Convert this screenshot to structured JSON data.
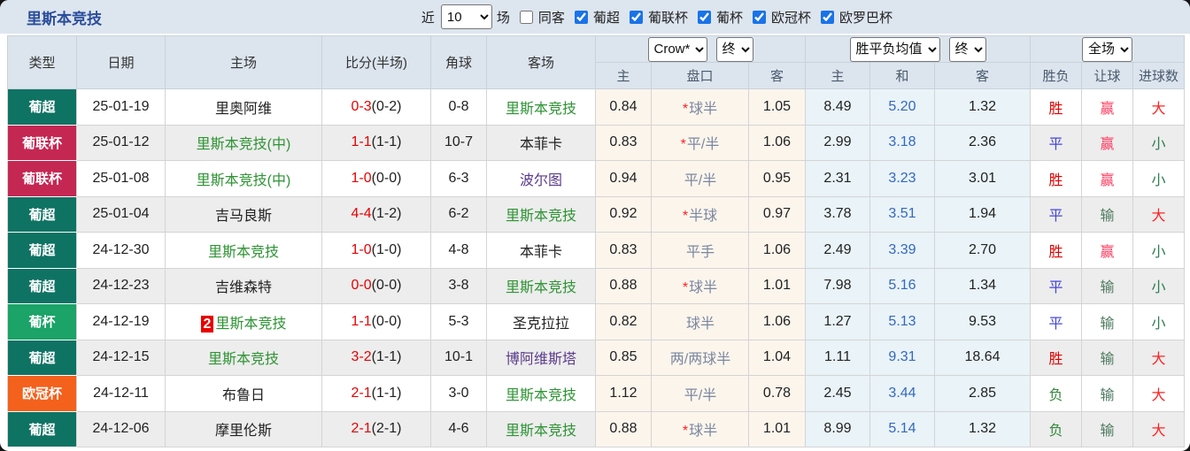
{
  "topbar": {
    "title": "里斯本竞技",
    "near_label": "近",
    "near_value": "10",
    "games_label": "场",
    "same_away_label": "同客",
    "leagues": [
      {
        "label": "葡超",
        "checked": true
      },
      {
        "label": "葡联杯",
        "checked": true
      },
      {
        "label": "葡杯",
        "checked": true
      },
      {
        "label": "欧冠杯",
        "checked": true
      },
      {
        "label": "欧罗巴杯",
        "checked": true
      }
    ]
  },
  "table": {
    "columns": {
      "type": "类型",
      "date": "日期",
      "home": "主场",
      "score": "比分(半场)",
      "corner": "角球",
      "away": "客场"
    },
    "dropdowns": {
      "odds_company": "Crow*",
      "odds_time": "终",
      "avg": "胜平负均值",
      "avg_time": "终",
      "scope": "全场"
    },
    "subcolumns": [
      "主",
      "盘口",
      "客",
      "主",
      "和",
      "客",
      "胜负",
      "让球",
      "进球数"
    ],
    "league_colors": {
      "葡超": "#0f7364",
      "葡联杯": "#c52753",
      "葡杯": "#1ba368",
      "欧冠杯": "#f4611c"
    },
    "status_colors": {
      "win_red": "#e60000",
      "draw_blue": "#4444e0",
      "lose_green": "#338a3e",
      "cover_win": "#ff3a5e",
      "cover_lose": "#4e7a60",
      "big": "#ff2222",
      "small": "#2e7d52",
      "avg_draw_blue": "#3468c0",
      "team_green": "#2e9434",
      "team_purple": "#5b3b8c"
    },
    "rows": [
      {
        "league": "葡超",
        "league_color": "#0f7364",
        "date": "25-01-19",
        "home": "里奥阿维",
        "home_cls": "t-dark",
        "home_prefix": "",
        "score": "0-3",
        "half": "(0-2)",
        "corner": "0-8",
        "away": "里斯本竞技",
        "away_cls": "t-green",
        "crow_home": "0.84",
        "star": "*",
        "handicap": "球半",
        "crow_away": "1.05",
        "avg_home": "8.49",
        "avg_draw": "5.20",
        "avg_away": "1.32",
        "result": "胜",
        "result_cls": "r-win",
        "cover": "赢",
        "cover_cls": "c-win",
        "goals": "大",
        "goals_cls": "g-big"
      },
      {
        "league": "葡联杯",
        "league_color": "#c52753",
        "date": "25-01-12",
        "home": "里斯本竞技(中)",
        "home_cls": "t-green",
        "home_prefix": "",
        "score": "1-1",
        "half": "(1-1)",
        "corner": "10-7",
        "away": "本菲卡",
        "away_cls": "t-dark",
        "crow_home": "0.83",
        "star": "*",
        "handicap": "平/半",
        "crow_away": "1.06",
        "avg_home": "2.99",
        "avg_draw": "3.18",
        "avg_away": "2.36",
        "result": "平",
        "result_cls": "r-draw",
        "cover": "赢",
        "cover_cls": "c-win",
        "goals": "小",
        "goals_cls": "g-small"
      },
      {
        "league": "葡联杯",
        "league_color": "#c52753",
        "date": "25-01-08",
        "home": "里斯本竞技(中)",
        "home_cls": "t-green",
        "home_prefix": "",
        "score": "1-0",
        "half": "(0-0)",
        "corner": "6-3",
        "away": "波尔图",
        "away_cls": "t-purple",
        "crow_home": "0.94",
        "star": "",
        "handicap": "平/半",
        "crow_away": "0.95",
        "avg_home": "2.31",
        "avg_draw": "3.23",
        "avg_away": "3.01",
        "result": "胜",
        "result_cls": "r-win",
        "cover": "赢",
        "cover_cls": "c-win",
        "goals": "小",
        "goals_cls": "g-small"
      },
      {
        "league": "葡超",
        "league_color": "#0f7364",
        "date": "25-01-04",
        "home": "吉马良斯",
        "home_cls": "t-dark",
        "home_prefix": "",
        "score": "4-4",
        "half": "(1-2)",
        "corner": "6-2",
        "away": "里斯本竞技",
        "away_cls": "t-green",
        "crow_home": "0.92",
        "star": "*",
        "handicap": "半球",
        "crow_away": "0.97",
        "avg_home": "3.78",
        "avg_draw": "3.51",
        "avg_away": "1.94",
        "result": "平",
        "result_cls": "r-draw",
        "cover": "输",
        "cover_cls": "c-lose",
        "goals": "大",
        "goals_cls": "g-big"
      },
      {
        "league": "葡超",
        "league_color": "#0f7364",
        "date": "24-12-30",
        "home": "里斯本竞技",
        "home_cls": "t-green",
        "home_prefix": "",
        "score": "1-0",
        "half": "(1-0)",
        "corner": "4-8",
        "away": "本菲卡",
        "away_cls": "t-dark",
        "crow_home": "0.83",
        "star": "",
        "handicap": "平手",
        "crow_away": "1.06",
        "avg_home": "2.49",
        "avg_draw": "3.39",
        "avg_away": "2.70",
        "result": "胜",
        "result_cls": "r-win",
        "cover": "赢",
        "cover_cls": "c-win",
        "goals": "小",
        "goals_cls": "g-small"
      },
      {
        "league": "葡超",
        "league_color": "#0f7364",
        "date": "24-12-23",
        "home": "吉维森特",
        "home_cls": "t-dark",
        "home_prefix": "",
        "score": "0-0",
        "half": "(0-0)",
        "corner": "3-8",
        "away": "里斯本竞技",
        "away_cls": "t-green",
        "crow_home": "0.88",
        "star": "*",
        "handicap": "球半",
        "crow_away": "1.01",
        "avg_home": "7.98",
        "avg_draw": "5.16",
        "avg_away": "1.34",
        "result": "平",
        "result_cls": "r-draw",
        "cover": "输",
        "cover_cls": "c-lose",
        "goals": "小",
        "goals_cls": "g-small"
      },
      {
        "league": "葡杯",
        "league_color": "#1ba368",
        "date": "24-12-19",
        "home": "里斯本竞技",
        "home_cls": "t-green",
        "home_prefix": "2",
        "score": "1-1",
        "half": "(0-0)",
        "corner": "5-3",
        "away": "圣克拉拉",
        "away_cls": "t-dark",
        "crow_home": "0.82",
        "star": "",
        "handicap": "球半",
        "crow_away": "1.06",
        "avg_home": "1.27",
        "avg_draw": "5.13",
        "avg_away": "9.53",
        "result": "平",
        "result_cls": "r-draw",
        "cover": "输",
        "cover_cls": "c-lose",
        "goals": "小",
        "goals_cls": "g-small"
      },
      {
        "league": "葡超",
        "league_color": "#0f7364",
        "date": "24-12-15",
        "home": "里斯本竞技",
        "home_cls": "t-green",
        "home_prefix": "",
        "score": "3-2",
        "half": "(1-1)",
        "corner": "10-1",
        "away": "博阿维斯塔",
        "away_cls": "t-purple",
        "crow_home": "0.85",
        "star": "",
        "handicap": "两/两球半",
        "crow_away": "1.04",
        "avg_home": "1.11",
        "avg_draw": "9.31",
        "avg_away": "18.64",
        "result": "胜",
        "result_cls": "r-win",
        "cover": "输",
        "cover_cls": "c-lose",
        "goals": "大",
        "goals_cls": "g-big"
      },
      {
        "league": "欧冠杯",
        "league_color": "#f4611c",
        "date": "24-12-11",
        "home": "布鲁日",
        "home_cls": "t-dark",
        "home_prefix": "",
        "score": "2-1",
        "half": "(1-1)",
        "corner": "3-0",
        "away": "里斯本竞技",
        "away_cls": "t-green",
        "crow_home": "1.12",
        "star": "",
        "handicap": "平/半",
        "crow_away": "0.78",
        "avg_home": "2.45",
        "avg_draw": "3.44",
        "avg_away": "2.85",
        "result": "负",
        "result_cls": "r-lose",
        "cover": "输",
        "cover_cls": "c-lose",
        "goals": "大",
        "goals_cls": "g-big"
      },
      {
        "league": "葡超",
        "league_color": "#0f7364",
        "date": "24-12-06",
        "home": "摩里伦斯",
        "home_cls": "t-dark",
        "home_prefix": "",
        "score": "2-1",
        "half": "(2-1)",
        "corner": "4-6",
        "away": "里斯本竞技",
        "away_cls": "t-green",
        "crow_home": "0.88",
        "star": "*",
        "handicap": "球半",
        "crow_away": "1.01",
        "avg_home": "8.99",
        "avg_draw": "5.14",
        "avg_away": "1.32",
        "result": "负",
        "result_cls": "r-lose",
        "cover": "输",
        "cover_cls": "c-lose",
        "goals": "大",
        "goals_cls": "g-big"
      }
    ]
  }
}
